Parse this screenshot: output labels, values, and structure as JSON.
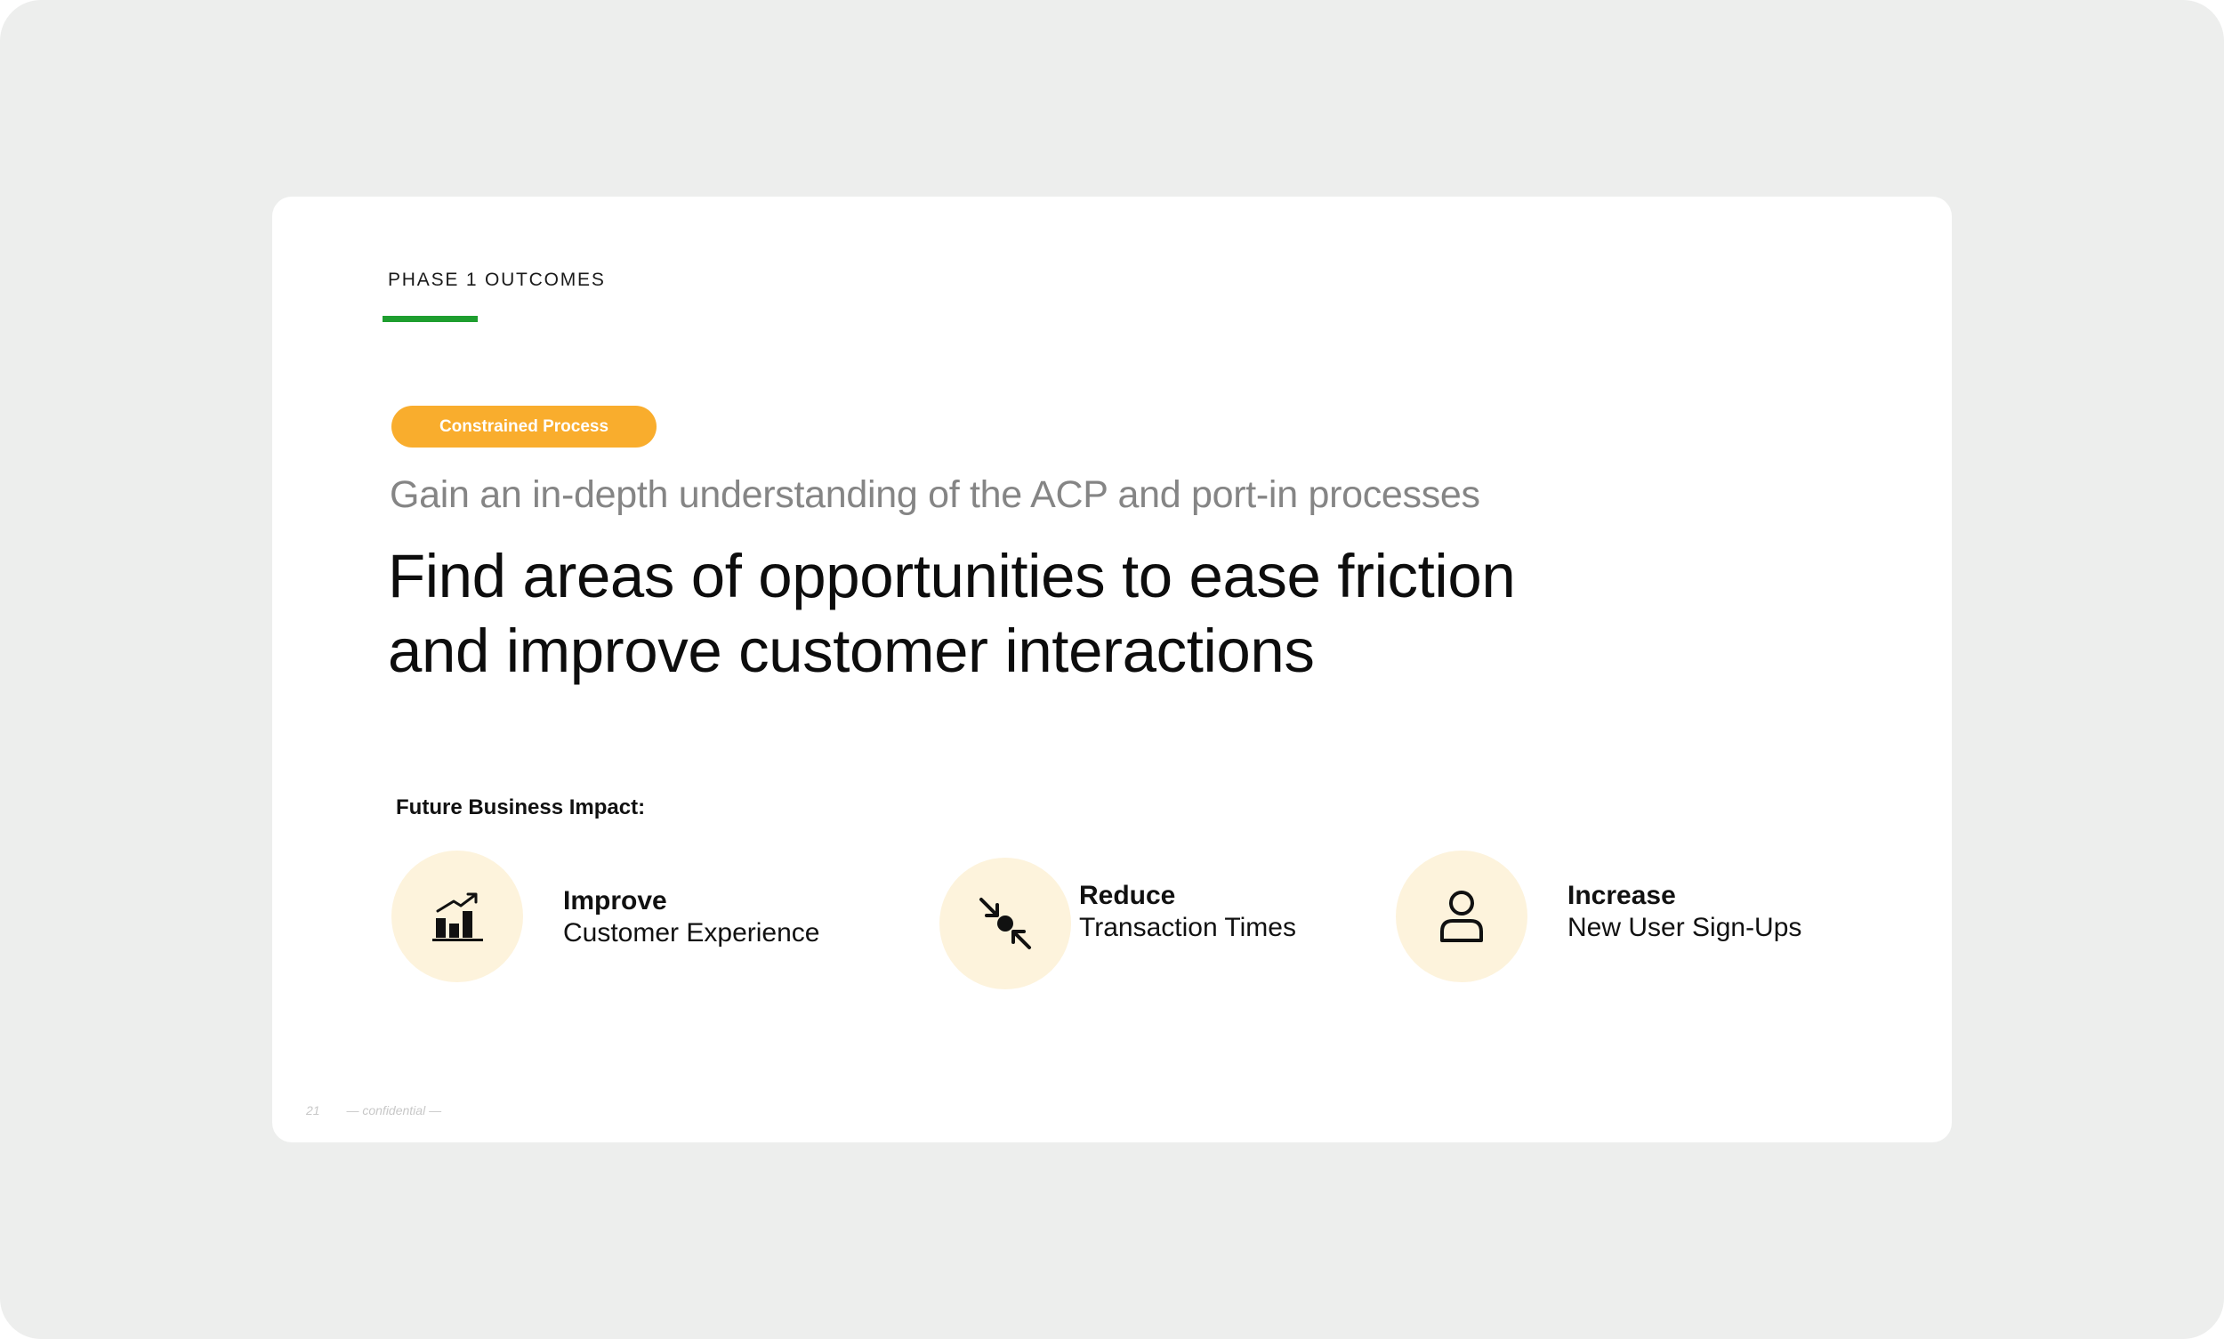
{
  "section": {
    "label": "PHASE 1 OUTCOMES"
  },
  "tag": {
    "label": "Constrained Process",
    "color": "#f9ad2d"
  },
  "subheading": "Gain an in-depth understanding of the ACP and port-in processes",
  "headline": {
    "line1": "Find areas of opportunities to ease friction",
    "line2": "and improve customer interactions"
  },
  "impact": {
    "label": "Future Business Impact:",
    "items": [
      {
        "icon": "bar-chart-growth-icon",
        "title": "Improve",
        "desc": "Customer Experience"
      },
      {
        "icon": "compress-arrows-icon",
        "title": "Reduce",
        "desc": "Transaction Times"
      },
      {
        "icon": "user-icon",
        "title": "Increase",
        "desc": "New User Sign-Ups"
      }
    ]
  },
  "footer": {
    "page_number": "21",
    "note": "— confidential —"
  },
  "colors": {
    "accent_green": "#1e9e2f",
    "accent_orange": "#f9ad2d",
    "icon_circle": "#fdf3dc"
  }
}
